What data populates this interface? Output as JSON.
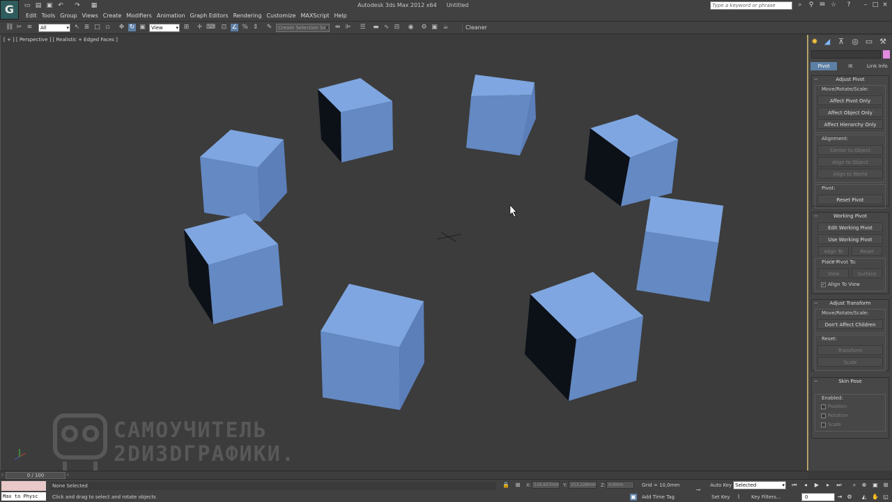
{
  "titlebar": {
    "app_name": "Autodesk 3ds Max 2012 x64",
    "document": "Untitled",
    "logo_letter": "G",
    "search_placeholder": "Type a keyword or phrase"
  },
  "menu": [
    "Edit",
    "Tools",
    "Group",
    "Views",
    "Create",
    "Modifiers",
    "Animation",
    "Graph Editors",
    "Rendering",
    "Customize",
    "MAXScript",
    "Help"
  ],
  "toolbar": {
    "selection_filter": "All",
    "reference_coord": "View",
    "named_selection_placeholder": "Create Selection Se",
    "cleaner_label": "Cleaner"
  },
  "viewport": {
    "label": "[ + ] [ Perspective ] [ Realistic + Edged Faces ]",
    "cube_color": "#6f97d4",
    "watermark_line1": "САМОУЧИТЕЛЬ",
    "watermark_line2": "2DИ3DГРАФИКИ."
  },
  "command_panel": {
    "subtabs": [
      "Pivot",
      "IK",
      "Link Info"
    ],
    "adjust_pivot": {
      "title": "Adjust Pivot",
      "move_label": "Move/Rotate/Scale:",
      "buttons": [
        "Affect Pivot Only",
        "Affect Object Only",
        "Affect Hierarchy Only"
      ],
      "alignment_label": "Alignment:",
      "alignment_buttons": [
        "Center to Object",
        "Align to Object",
        "Align to World"
      ],
      "pivot_label": "Pivot:",
      "reset_pivot": "Reset Pivot"
    },
    "working_pivot": {
      "title": "Working Pivot",
      "edit": "Edit Working Pivot",
      "use": "Use Working Pivot",
      "align_to_view": "Align To View",
      "reset": "Reset",
      "place_label": "Place Pivot To:",
      "view": "View",
      "surface": "Surface",
      "align_check": "Align To View"
    },
    "adjust_transform": {
      "title": "Adjust Transform",
      "move_label": "Move/Rotate/Scale:",
      "dont_affect": "Don't Affect Children",
      "reset_label": "Reset:",
      "transform": "Transform",
      "scale": "Scale"
    },
    "skin_pose": {
      "title": "Skin Pose",
      "enabled_label": "Enabled:",
      "checks": [
        "Position",
        "Rotation",
        "Scale"
      ]
    }
  },
  "timeslider": {
    "frame_readout": "0 / 100"
  },
  "status": {
    "maxscript_text": "Max to Physc",
    "selection": "None Selected",
    "prompt": "Click and drag to select and rotate objects",
    "x_label": "X:",
    "x_value": "116,637mm",
    "y_label": "Y:",
    "y_value": "253,228mm",
    "z_label": "Z:",
    "z_value": "0,0mm",
    "grid": "Grid = 10,0mm",
    "time_tag": "Add Time Tag",
    "auto_key": "Auto Key",
    "set_key": "Set Key",
    "key_mode": "Selected",
    "key_filters": "Key Filters...",
    "frame": "0"
  }
}
